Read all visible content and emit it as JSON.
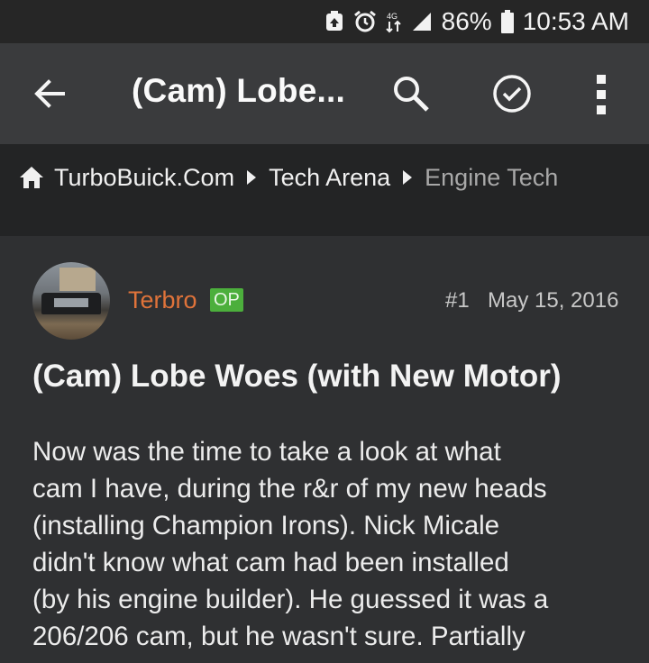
{
  "status_bar": {
    "battery_percent": "86%",
    "time": "10:53 AM",
    "icons": [
      "battery-saver-icon",
      "alarm-icon",
      "data-arrows-icon",
      "signal-icon",
      "battery-icon"
    ]
  },
  "toolbar": {
    "title": "(Cam) Lobe...",
    "icons": [
      "back-arrow-icon",
      "search-icon",
      "check-circle-icon",
      "more-vertical-icon"
    ]
  },
  "breadcrumb": {
    "items": [
      "TurboBuick.Com",
      "Tech Arena",
      "Engine Tech"
    ]
  },
  "post": {
    "author": "Terbro",
    "badge": "OP",
    "number": "#1",
    "date": "May 15, 2016",
    "title": "(Cam) Lobe Woes (with New Motor)",
    "body_lines": [
      "Now was the time to take a look at what",
      "cam I have, during the r&r of my new heads",
      "(installing Champion Irons). Nick Micale",
      "didn't know what cam had been installed",
      "(by his engine builder). He guessed it was a",
      "206/206 cam, but he wasn't sure. Partially"
    ]
  },
  "colors": {
    "status_bg": "#262626",
    "toolbar_bg": "#3a3b3d",
    "breadcrumb_bg": "#232425",
    "page_bg": "#2f3032",
    "username": "#e0733a",
    "op_badge": "#4caf3c"
  }
}
